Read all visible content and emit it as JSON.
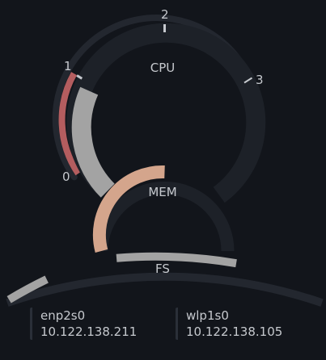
{
  "colors": {
    "background": "#12151b",
    "track": "#23272f",
    "track_dark": "#1b1f26",
    "cpu_core": "#a3a3a3",
    "cpu_alert": "#b45d5f",
    "mem": "#d4a58c",
    "fs": "#a3a3a3",
    "text": "#c6c9ce"
  },
  "cpu": {
    "label": "CPU",
    "tick_labels": [
      "0",
      "1",
      "2",
      "3"
    ],
    "core_usage_pct": 45,
    "alert_usage_pct": 45
  },
  "mem": {
    "label": "MEM",
    "usage_pct": 48
  },
  "fs": {
    "label": "FS"
  },
  "network": [
    {
      "interface": "enp2s0",
      "ip": "10.122.138.211"
    },
    {
      "interface": "wlp1s0",
      "ip": "10.122.138.105"
    }
  ]
}
